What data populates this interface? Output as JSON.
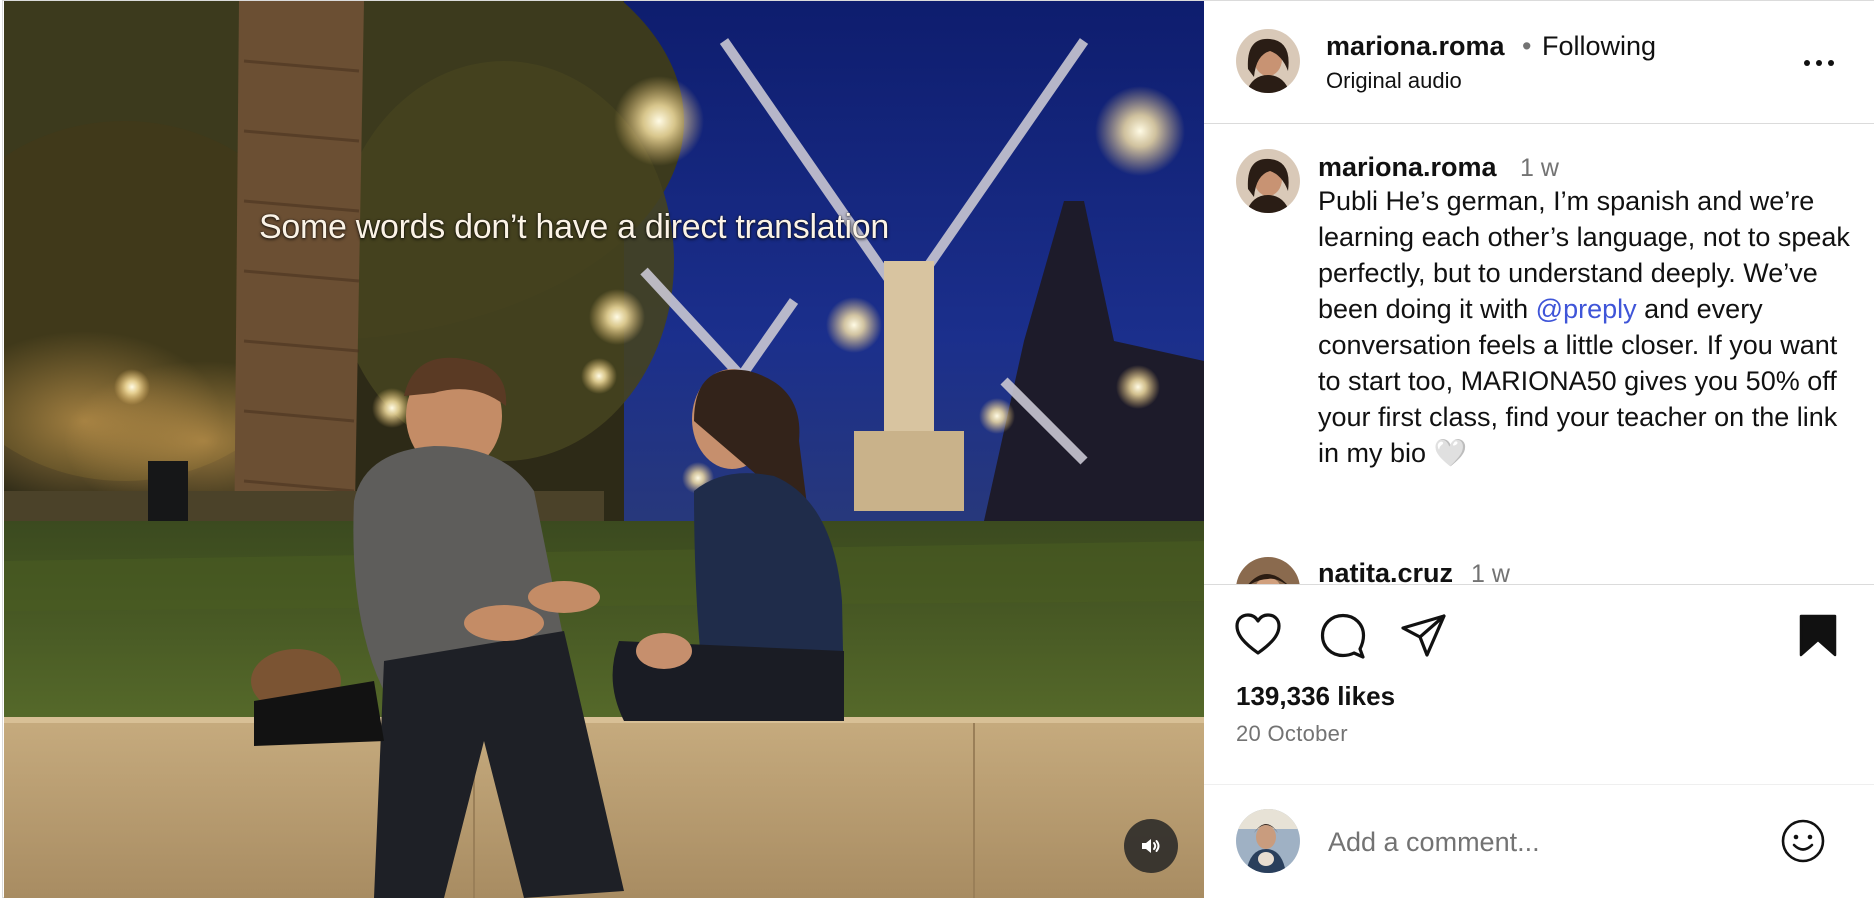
{
  "media": {
    "overlay_caption": "Some words don’t have a direct translation",
    "mute_icon": "speaker-icon"
  },
  "header": {
    "username": "mariona.roma",
    "separator": "•",
    "follow_status": "Following",
    "audio_label": "Original audio",
    "more_icon": "ellipsis-icon"
  },
  "caption": {
    "username": "mariona.roma",
    "time": "1 w",
    "text_before": "Publi He’s german, I’m spanish and we’re learning each other’s language, not to speak perfectly, but to understand deeply. We’ve been doing it with ",
    "mention": "@preply",
    "text_after": " and every conversation feels a little closer. If you want to start too, MARIONA50 gives you 50% off your first class, find your teacher on the link in my bio 🤍"
  },
  "comments": [
    {
      "username": "natita.cruz",
      "time": "1 w"
    }
  ],
  "actions": {
    "likes": "139,336 likes",
    "date": "20 October",
    "icons": [
      "heart-icon",
      "comment-icon",
      "share-icon",
      "bookmark-icon"
    ]
  },
  "comment_box": {
    "placeholder": "Add a comment...",
    "emoji_icon": "smiley-icon"
  },
  "colors": {
    "mention": "#3f55d8",
    "secondary_text": "#737373",
    "border": "#dbdbdb"
  }
}
